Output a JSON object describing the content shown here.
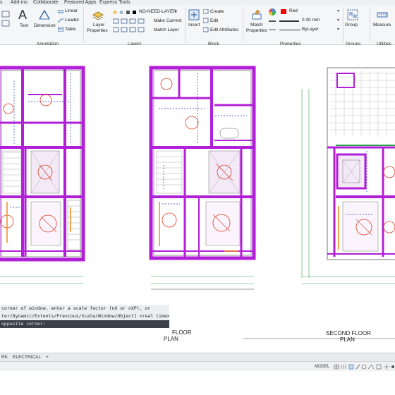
{
  "tabs": [
    "Add-ins",
    "Collaborate",
    "Featured Apps",
    "Express Tools"
  ],
  "ribbon": {
    "text": "Text",
    "dimension": "Dimension",
    "linear": "Linear",
    "leader": "Leader",
    "table": "Table",
    "annotation_panel": "Annotation",
    "layer_properties": [
      "Layer",
      "Properties"
    ],
    "layer_name": "NO-NEED-LAYER",
    "make_current": "Make Current",
    "match_layer": "Match Layer",
    "layers_panel": "Layers",
    "insert": "Insert",
    "create": "Create",
    "edit": "Edit",
    "edit_attributes": "Edit Attributes",
    "block_panel": "Block",
    "match_properties": [
      "Match",
      "Properties"
    ],
    "color": "Red",
    "lineweight": "0.30 mm",
    "linetype": "ByLayer",
    "properties_panel": "Properties",
    "group": "Group",
    "groups_panel": "Groups",
    "measure": "Measure",
    "utilities_panel": "Utilities"
  },
  "drawing": {
    "plan_left": [
      "FLOOR",
      "PLAN"
    ],
    "plan_right": [
      "SECOND FLOOR",
      "PLAN"
    ]
  },
  "command": {
    "lines": [
      "corner of window, enter a scale factor (nX or nXP), or",
      "ter/Dynamic/Extents/Previous/Scale/Window/Object] <real time>:",
      "opposite corner:"
    ]
  },
  "layout_tabs": [
    "RK",
    "ELECTRICAL",
    "+"
  ],
  "status": {
    "model": "MODEL"
  },
  "colors": {
    "wall": "#b21fd8",
    "accent": "#e03a1e",
    "red": "#ff0000"
  }
}
